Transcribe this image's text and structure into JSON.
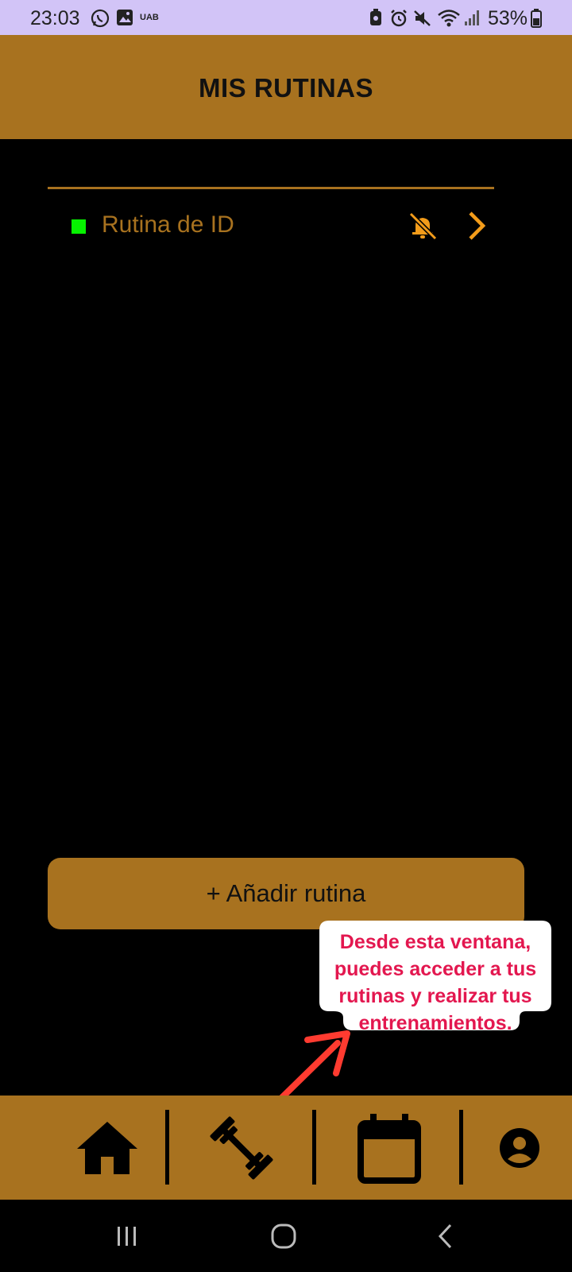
{
  "status_bar": {
    "time": "23:03",
    "carrier_label": "UAB",
    "battery": "53%",
    "icons": [
      "whatsapp-icon",
      "gallery-icon",
      "battery-saver-icon",
      "alarm-icon",
      "mute-icon",
      "wifi-icon",
      "signal-icon",
      "battery-icon"
    ]
  },
  "header": {
    "title": "MIS RUTINAS"
  },
  "routines": [
    {
      "name": "Rutina de ID",
      "status_color": "#06f200"
    }
  ],
  "actions": {
    "add_routine_label": "+ Añadir rutina"
  },
  "tooltip": {
    "lines": [
      "Desde esta ventana,",
      "puedes acceder a tus",
      "rutinas y realizar tus",
      "entrenamientos."
    ]
  },
  "bottom_nav": {
    "items": [
      "home-icon",
      "dumbbell-icon",
      "calendar-icon",
      "profile-icon"
    ]
  },
  "colors": {
    "accent": "#a8721f",
    "icon_orange": "#f39c1a",
    "status_bar": "#d2c4f7",
    "tooltip_text": "#e3174f",
    "arrow": "#ff3b30"
  }
}
